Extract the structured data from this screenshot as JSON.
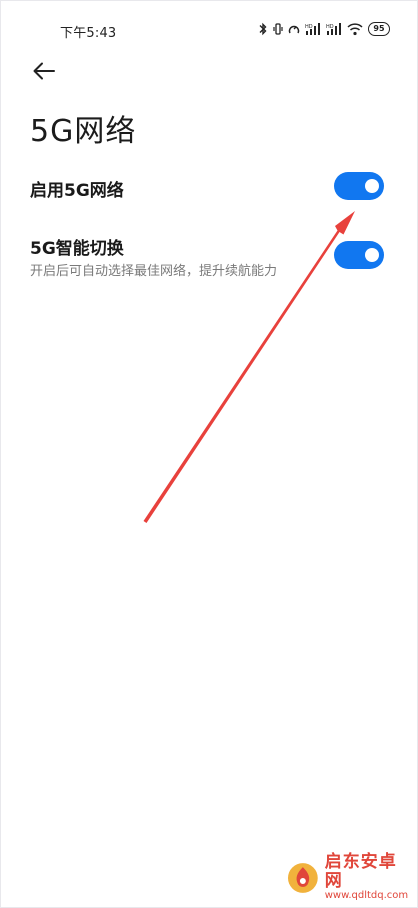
{
  "status_bar": {
    "time": "下午5:43",
    "battery": "95"
  },
  "header": {
    "back_icon": "arrow-left-icon",
    "title": "5G网络"
  },
  "settings": [
    {
      "label": "启用5G网络",
      "description": "",
      "enabled": true
    },
    {
      "label": "5G智能切换",
      "description": "开启后可自动选择最佳网络，提升续航能力",
      "enabled": true
    }
  ],
  "annotation": {
    "arrow_color": "#e8413c"
  },
  "watermark": {
    "title": "启东安卓网",
    "url": "www.qdltdq.com"
  },
  "colors": {
    "accent": "#1177f0",
    "text_primary": "#1a1a1a",
    "text_secondary": "#7a7a7a"
  }
}
